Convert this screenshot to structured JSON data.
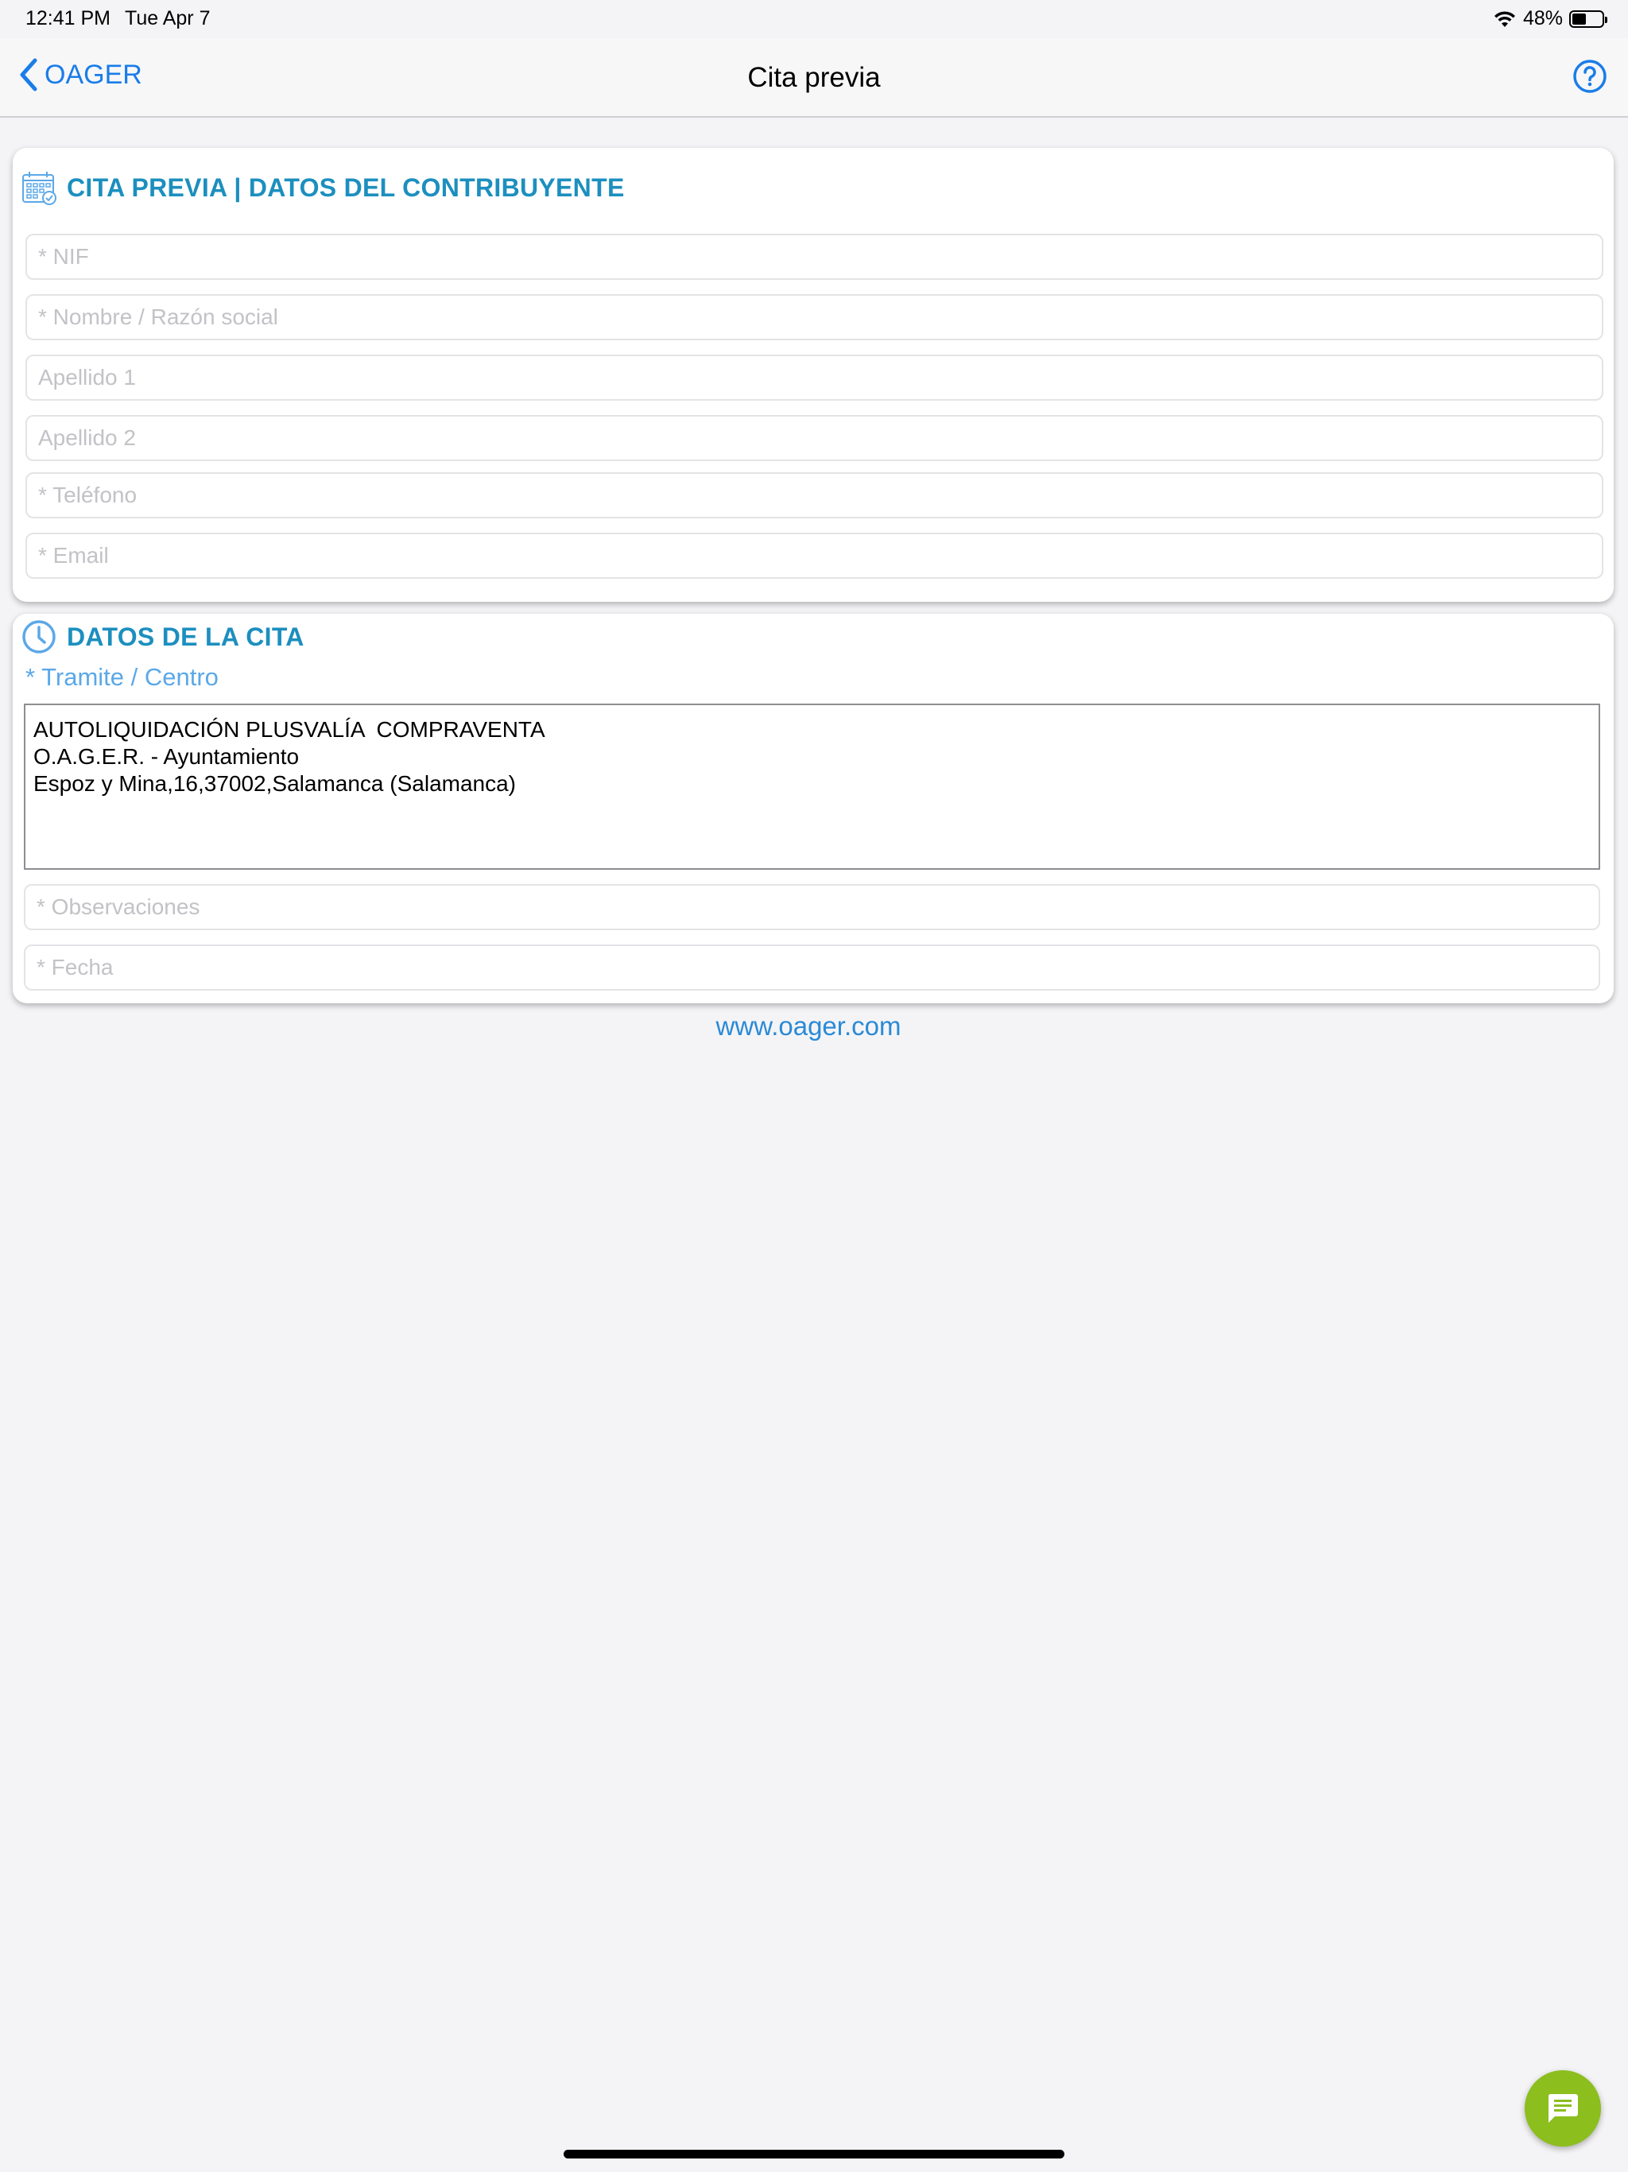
{
  "status_bar": {
    "time": "12:41 PM",
    "date": "Tue Apr 7",
    "battery_text": "48%",
    "battery_level": 0.48,
    "wifi_icon": "wifi-icon"
  },
  "nav": {
    "back_label": "OAGER",
    "title": "Cita previa",
    "help_icon": "help-circle-icon"
  },
  "taxpayer_section": {
    "title": "CITA PREVIA | DATOS DEL CONTRIBUYENTE",
    "icon": "calendar-icon",
    "fields": [
      {
        "placeholder": "* NIF",
        "value": ""
      },
      {
        "placeholder": "* Nombre / Razón social",
        "value": ""
      },
      {
        "placeholder": "Apellido 1",
        "value": ""
      },
      {
        "placeholder": "Apellido 2",
        "value": ""
      },
      {
        "placeholder": "* Teléfono",
        "value": ""
      },
      {
        "placeholder": "* Email",
        "value": ""
      }
    ]
  },
  "appointment_section": {
    "title": "DATOS DE LA CITA",
    "icon": "clock-icon",
    "tramite_label": "* Tramite / Centro",
    "tramite_lines": [
      "AUTOLIQUIDACIÓN PLUSVALÍA  COMPRAVENTA",
      "O.A.G.E.R. - Ayuntamiento",
      "Espoz y Mina,16,37002,Salamanca (Salamanca)"
    ],
    "fields": [
      {
        "placeholder": "* Observaciones",
        "value": ""
      },
      {
        "placeholder": "* Fecha",
        "value": ""
      }
    ]
  },
  "footer": {
    "link_text": "www.oager.com"
  },
  "chat_button": {
    "icon": "chat-icon"
  },
  "colors": {
    "accent_blue": "#1a7de8",
    "section_title": "#1c8fbf",
    "chat_green": "#8cbe1e"
  }
}
